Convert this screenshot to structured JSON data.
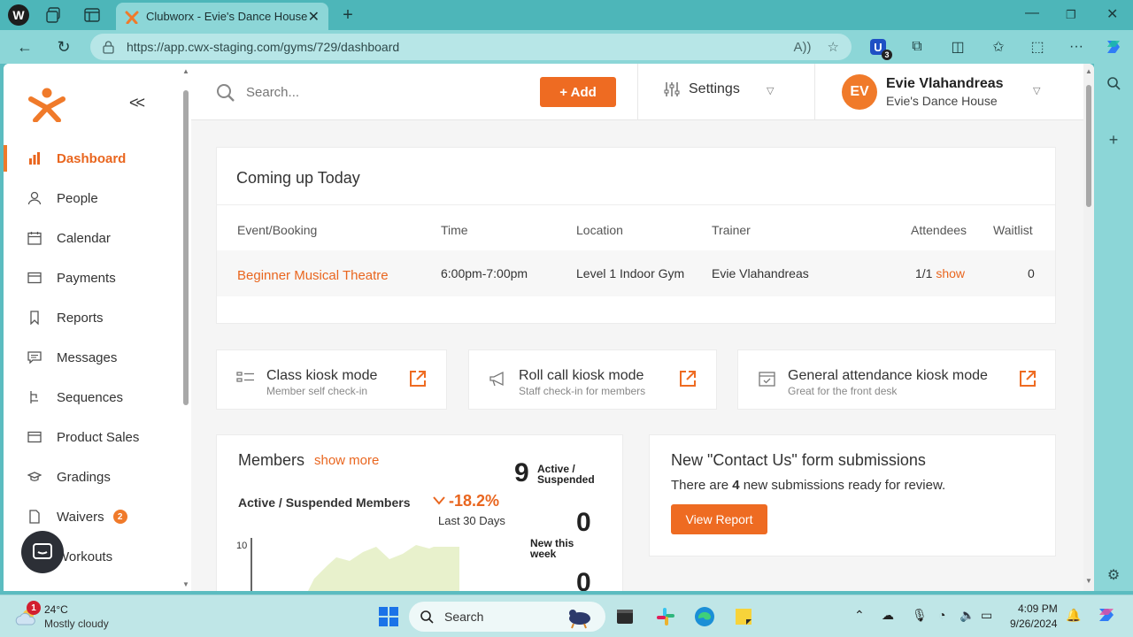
{
  "browser": {
    "tab_title": "Clubworx - Evie's Dance House",
    "url": "https://app.cwx-staging.com/gyms/729/dashboard",
    "extension_badge_count": "3"
  },
  "sidebar": {
    "items": [
      {
        "label": "Dashboard",
        "icon": "bar-chart-icon",
        "active": true
      },
      {
        "label": "People",
        "icon": "person-icon"
      },
      {
        "label": "Calendar",
        "icon": "calendar-icon"
      },
      {
        "label": "Payments",
        "icon": "wallet-icon"
      },
      {
        "label": "Reports",
        "icon": "bookmark-icon"
      },
      {
        "label": "Messages",
        "icon": "message-icon"
      },
      {
        "label": "Sequences",
        "icon": "sequence-icon"
      },
      {
        "label": "Product Sales",
        "icon": "product-icon"
      },
      {
        "label": "Gradings",
        "icon": "grad-cap-icon"
      },
      {
        "label": "Waivers",
        "icon": "document-icon",
        "badge": "2"
      },
      {
        "label": "Workouts",
        "icon": "workout-icon"
      }
    ]
  },
  "header": {
    "search_placeholder": "Search...",
    "add_label": "+ Add",
    "settings_label": "Settings",
    "user_initials": "EV",
    "user_name": "Evie Vlahandreas",
    "user_gym": "Evie's Dance House"
  },
  "coming_up": {
    "title": "Coming up Today",
    "columns": [
      "Event/Booking",
      "Time",
      "Location",
      "Trainer",
      "Attendees",
      "Waitlist"
    ],
    "rows": [
      {
        "event": "Beginner Musical Theatre",
        "time": "6:00pm-7:00pm",
        "location": "Level 1 Indoor Gym",
        "trainer": "Evie Vlahandreas",
        "attendees": "1/1",
        "attendees_link": "show",
        "waitlist": "0"
      }
    ]
  },
  "kiosks": [
    {
      "title": "Class kiosk mode",
      "subtitle": "Member self check-in",
      "icon": "list-icon"
    },
    {
      "title": "Roll call kiosk mode",
      "subtitle": "Staff check-in for members",
      "icon": "megaphone-icon"
    },
    {
      "title": "General attendance kiosk mode",
      "subtitle": "Great for the front desk",
      "icon": "calendar-check-icon"
    }
  ],
  "members": {
    "title": "Members",
    "show_more": "show more",
    "subtitle": "Active / Suspended Members",
    "change_pct": "-18.2%",
    "change_period": "Last 30 Days",
    "stat1_value": "9",
    "stat1_label": "Active / Suspended",
    "stat2_value": "0",
    "stat2_label": "New this week",
    "stat3_value": "0",
    "chart_y_tick": "10"
  },
  "contact": {
    "title": "New \"Contact Us\" form submissions",
    "text_pre": "There are ",
    "count": "4",
    "text_post": " new submissions ready for review.",
    "button": "View Report"
  },
  "taskbar": {
    "weather_alert": "1",
    "temperature": "24°C",
    "weather": "Mostly cloudy",
    "search_label": "Search",
    "time": "4:09 PM",
    "date": "9/26/2024"
  },
  "colors": {
    "accent": "#ee6b22",
    "browser": "#8cd6d7"
  }
}
